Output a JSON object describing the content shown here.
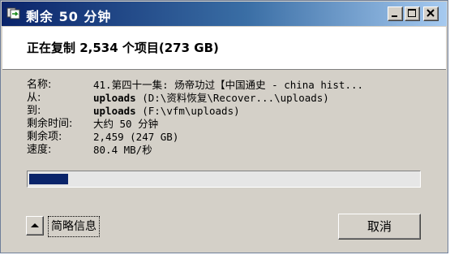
{
  "window": {
    "title": "剩余 50 分钟",
    "icon": "copy-files-icon",
    "title_bar_gradient": [
      "#0a246a",
      "#a6caf0"
    ]
  },
  "header": {
    "summary": "正在复制 2,534 个项目(273 GB)"
  },
  "details": {
    "name_label": "名称:",
    "name_value": "41.第四十一集: 炀帝功过【中国通史 - china hist...",
    "from_label": "从:",
    "from_bold": "uploads",
    "from_path": " (D:\\资料恢复\\Recover...\\uploads)",
    "to_label": "到:",
    "to_bold": "uploads",
    "to_path": " (F:\\vfm\\uploads)",
    "time_left_label": "剩余时间:",
    "time_left_value": "大约 50 分钟",
    "items_left_label": "剩余项:",
    "items_left_value": "2,459 (247 GB)",
    "speed_label": "速度:",
    "speed_value": "80.4 MB/秒"
  },
  "progress": {
    "fraction": 0.1
  },
  "buttons": {
    "fewer_details": "简略信息",
    "cancel": "取消"
  }
}
